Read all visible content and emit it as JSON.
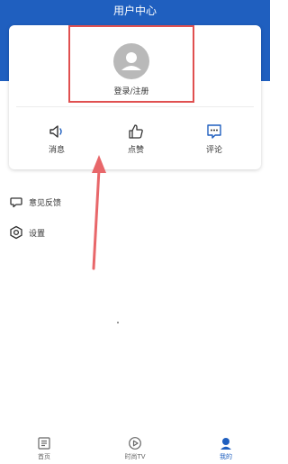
{
  "header": {
    "title": "用户中心"
  },
  "profile": {
    "login_label": "登录/注册"
  },
  "actions": [
    {
      "label": "消息",
      "icon": "speaker-icon"
    },
    {
      "label": "点赞",
      "icon": "thumbs-up-icon"
    },
    {
      "label": "评论",
      "icon": "comment-icon"
    }
  ],
  "menu": [
    {
      "label": "意见反馈",
      "icon": "feedback-icon"
    },
    {
      "label": "设置",
      "icon": "settings-icon"
    }
  ],
  "bottom_nav": [
    {
      "label": "首页",
      "icon": "news-icon",
      "active": false
    },
    {
      "label": "时尚TV",
      "icon": "play-icon",
      "active": false
    },
    {
      "label": "我的",
      "icon": "user-icon",
      "active": true
    }
  ],
  "colors": {
    "brand": "#1f5fbf",
    "highlight": "#e05050",
    "arrow": "#e8676a"
  }
}
